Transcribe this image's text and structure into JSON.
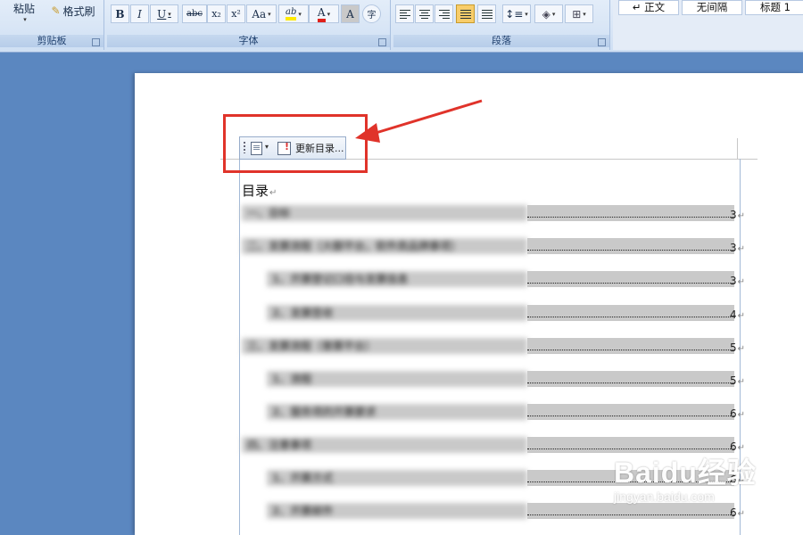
{
  "ribbon": {
    "clipboard": {
      "paste_label": "粘贴",
      "format_painter_label": "格式刷",
      "group_label": "剪贴板"
    },
    "font": {
      "bold": "B",
      "italic": "I",
      "underline": "U",
      "strikethrough": "abc",
      "subscript": "x₂",
      "superscript": "x²",
      "change_case": "Aa",
      "highlight": "ab",
      "font_color": "A",
      "char_shading": "A",
      "enclose": "字",
      "group_label": "字体"
    },
    "paragraph": {
      "group_label": "段落"
    },
    "styles": [
      "↵ 正文",
      "无间隔",
      "标题 1"
    ]
  },
  "document": {
    "toc_toolbar": {
      "update_label": "更新目录..."
    },
    "toc_title": "目录",
    "para_mark": "↵",
    "toc_entries": [
      {
        "text": "一、目标",
        "page": "3"
      },
      {
        "text": "二、发票流程（大额平台，软件类品牌事项）",
        "page": "3"
      },
      {
        "text": "1、开票登记口径与发票信息",
        "page": "3"
      },
      {
        "text": "2、发票签收",
        "page": "4"
      },
      {
        "text": "三、发票流程（普票平台）",
        "page": "5"
      },
      {
        "text": "1、流程",
        "page": "5"
      },
      {
        "text": "2、服务项的开票要求",
        "page": "6"
      },
      {
        "text": "四、注意事项",
        "page": "6"
      },
      {
        "text": "1、开票方式",
        "page": "6"
      },
      {
        "text": "2、开票邮件",
        "page": "6"
      }
    ]
  },
  "watermark": {
    "main": "Baidu经验",
    "sub": "jingyan.baidu.com"
  },
  "colors": {
    "highlight_box": "#e0332a",
    "ribbon_bg": "#dbe7f6",
    "app_bg": "#5b87c0"
  }
}
